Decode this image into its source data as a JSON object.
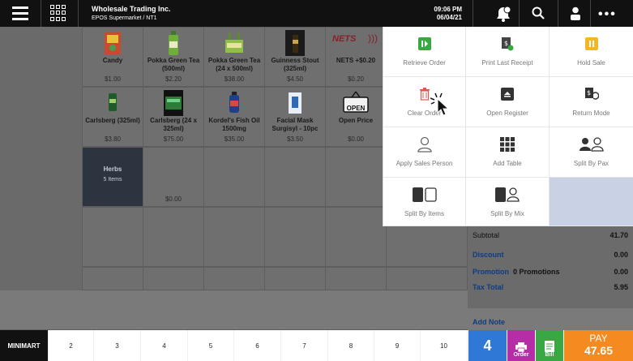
{
  "topbar": {
    "company": "Wholesale Trading Inc.",
    "location": "EPOS Supermarket / NT1",
    "time": "09:06 PM",
    "date": "06/04/21"
  },
  "products": [
    {
      "name": "Candy",
      "price": "$1.00"
    },
    {
      "name": "Pokka Green Tea (500ml)",
      "price": "$2.20"
    },
    {
      "name": "Pokka Green Tea (24 x 500ml)",
      "price": "$38.00"
    },
    {
      "name": "Guinness Stout (325ml)",
      "price": "$4.50"
    },
    {
      "name": "NETS +$0.20",
      "price": "$0.20"
    },
    {
      "name": "Carlsberg (325ml)",
      "price": "$3.80"
    },
    {
      "name": "Carlsberg (24 x 325ml)",
      "price": "$75.00"
    },
    {
      "name": "Kordel's Fish Oil 1500mg",
      "price": "$35.00"
    },
    {
      "name": "Facial Mask Surgisyl - 10pc",
      "price": "$3.50"
    },
    {
      "name": "Open Price",
      "price": "$0.00"
    }
  ],
  "herbs": {
    "name": "Herbs",
    "items": "5 Items",
    "extra_price": "$0.00"
  },
  "nets_logo": "NETS",
  "open_sign": "OPEN",
  "menu": [
    {
      "label": "Retrieve Order",
      "icon": "retrieve-order-icon",
      "color": "#3aa842"
    },
    {
      "label": "Print Last Receipt",
      "icon": "print-receipt-icon",
      "color": "#444444"
    },
    {
      "label": "Hold Sale",
      "icon": "pause-icon",
      "color": "#f2b728"
    },
    {
      "label": "Clear Order",
      "icon": "trash-icon",
      "color": "#e0574d"
    },
    {
      "label": "Open Register",
      "icon": "open-register-icon",
      "color": "#333333"
    },
    {
      "label": "Return Mode",
      "icon": "return-mode-icon",
      "color": "#333333"
    },
    {
      "label": "Apply Sales Person",
      "icon": "person-outline-icon",
      "color": "#666666"
    },
    {
      "label": "Add Table",
      "icon": "table-grid-icon",
      "color": "#333333"
    },
    {
      "label": "Split By Pax",
      "icon": "split-pax-icon",
      "color": "#333333"
    },
    {
      "label": "Split By Items",
      "icon": "split-items-icon",
      "color": "#333333"
    },
    {
      "label": "Split By Mix",
      "icon": "split-mix-icon",
      "color": "#333333"
    }
  ],
  "summary": {
    "subtotal_label": "Subtotal",
    "subtotal": "41.70",
    "discount_label": "Discount",
    "discount": "0.00",
    "promotion_label": "Promotion",
    "promotion_count": "0 Promotions",
    "promotion": "0.00",
    "tax_label": "Tax Total",
    "tax": "5.95",
    "add_note": "Add Note"
  },
  "tabs": [
    "MINIMART",
    "2",
    "3",
    "4",
    "5",
    "6",
    "7",
    "8",
    "9",
    "10"
  ],
  "actions": {
    "count": "4",
    "order": "Order",
    "bill": "Bill",
    "pay_label": "PAY",
    "pay_amount": "47.65"
  },
  "colors": {
    "accent": "#2f78d6",
    "order": "#b52ea6",
    "bill": "#3aa842",
    "pay": "#f58a21"
  }
}
